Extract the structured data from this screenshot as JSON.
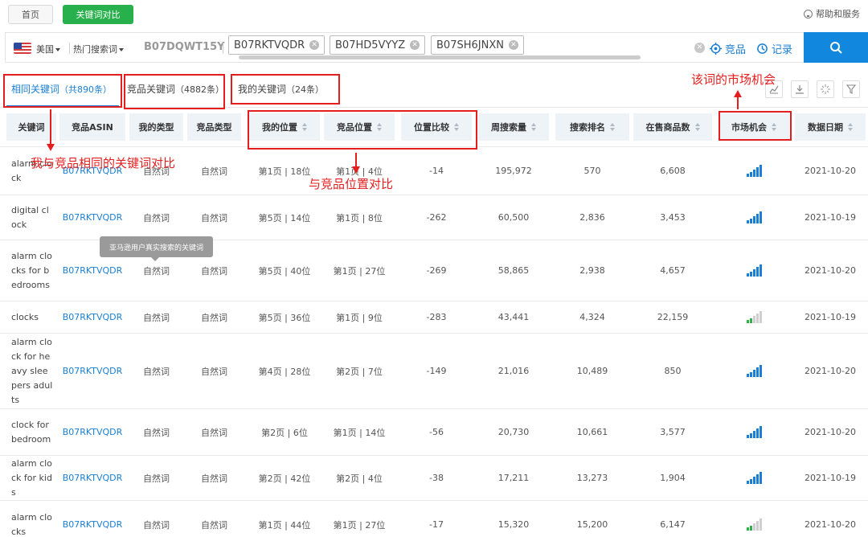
{
  "topbar": {
    "home": "首页",
    "compare": "关键词对比",
    "help": "帮助和服务"
  },
  "search": {
    "country": "美国",
    "hot_words": "热门搜索词",
    "my_asin": "B07DQWT15Y",
    "chips": [
      "B07RKTVQDR",
      "B07HD5VYYZ",
      "B07SH6JNXN"
    ],
    "competitor_link": "竞品",
    "record_link": "记录"
  },
  "tabs": [
    {
      "label": "相同关键词",
      "count": "（共890条）"
    },
    {
      "label": "竞品关键词",
      "count": "（4882条）"
    },
    {
      "label": "我的关键词",
      "count": "（24条）"
    }
  ],
  "columns": [
    "关键词",
    "竞品ASIN",
    "我的类型",
    "竞品类型",
    "我的位置",
    "竞品位置",
    "位置比较",
    "周搜索量",
    "搜索排名",
    "在售商品数",
    "市场机会",
    "数据日期"
  ],
  "rows": [
    {
      "keyword": "alarm clock",
      "asin": "B07RKTVQDR",
      "my_type": "自然词",
      "comp_type": "自然词",
      "my_pos": "第1页 | 18位",
      "comp_pos": "第1页 | 4位",
      "diff": "-14",
      "weekly": "195,972",
      "rank": "570",
      "products": "6,608",
      "opportunity": 5,
      "date": "2021-10-20"
    },
    {
      "keyword": "digital clock",
      "asin": "B07RKTVQDR",
      "my_type": "自然词",
      "comp_type": "自然词",
      "my_pos": "第5页 | 14位",
      "comp_pos": "第1页 | 8位",
      "diff": "-262",
      "weekly": "60,500",
      "rank": "2,836",
      "products": "3,453",
      "opportunity": 5,
      "date": "2021-10-19"
    },
    {
      "keyword": "alarm clocks for bedrooms",
      "asin": "B07RKTVQDR",
      "my_type": "自然词",
      "comp_type": "自然词",
      "my_pos": "第5页 | 40位",
      "comp_pos": "第1页 | 27位",
      "diff": "-269",
      "weekly": "58,865",
      "rank": "2,938",
      "products": "4,657",
      "opportunity": 5,
      "date": "2021-10-20"
    },
    {
      "keyword": "clocks",
      "asin": "B07RKTVQDR",
      "my_type": "自然词",
      "comp_type": "自然词",
      "my_pos": "第5页 | 36位",
      "comp_pos": "第1页 | 9位",
      "diff": "-283",
      "weekly": "43,441",
      "rank": "4,324",
      "products": "22,159",
      "opportunity": 2,
      "date": "2021-10-19"
    },
    {
      "keyword": "alarm clock for heavy sleepers adults",
      "asin": "B07RKTVQDR",
      "my_type": "自然词",
      "comp_type": "自然词",
      "my_pos": "第4页 | 28位",
      "comp_pos": "第2页 | 7位",
      "diff": "-149",
      "weekly": "21,016",
      "rank": "10,489",
      "products": "850",
      "opportunity": 5,
      "date": "2021-10-20"
    },
    {
      "keyword": "clock for bedroom",
      "asin": "B07RKTVQDR",
      "my_type": "自然词",
      "comp_type": "自然词",
      "my_pos": "第2页 | 6位",
      "comp_pos": "第1页 | 14位",
      "diff": "-56",
      "weekly": "20,730",
      "rank": "10,661",
      "products": "3,577",
      "opportunity": 5,
      "date": "2021-10-20"
    },
    {
      "keyword": "alarm clock for kids",
      "asin": "B07RKTVQDR",
      "my_type": "自然词",
      "comp_type": "自然词",
      "my_pos": "第2页 | 42位",
      "comp_pos": "第2页 | 4位",
      "diff": "-38",
      "weekly": "17,211",
      "rank": "13,273",
      "products": "1,904",
      "opportunity": 5,
      "date": "2021-10-19"
    },
    {
      "keyword": "alarm clocks",
      "asin": "B07RKTVQDR",
      "my_type": "自然词",
      "comp_type": "自然词",
      "my_pos": "第1页 | 44位",
      "comp_pos": "第1页 | 27位",
      "diff": "-17",
      "weekly": "15,320",
      "rank": "15,200",
      "products": "6,147",
      "opportunity": 2,
      "date": "2021-10-20"
    }
  ],
  "tooltip": "亚马逊用户真实搜索的关键词",
  "annotations": {
    "same_keywords": "我与竞品相同的关键词对比",
    "position_compare": "与竞品位置对比",
    "market_opportunity": "该词的市场机会"
  },
  "colors": {
    "accent": "#1a7fd4",
    "green": "#27b04c",
    "annotation": "#e41e1e"
  }
}
